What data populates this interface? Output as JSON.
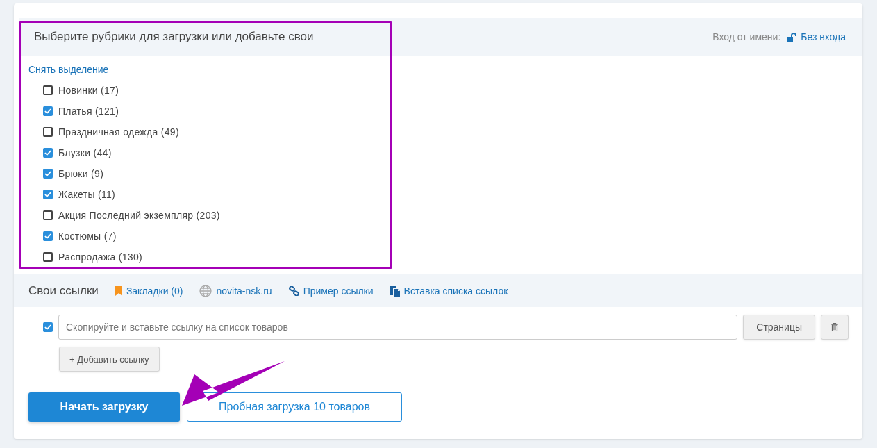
{
  "header": {
    "title": "Выберите рубрики для загрузки или добавьте свои",
    "login_label": "Вход от имени:",
    "login_value": "Без входа"
  },
  "deselect_link": "Снять выделение",
  "categories": [
    {
      "label": "Новинки (17)",
      "checked": false
    },
    {
      "label": "Платья (121)",
      "checked": true
    },
    {
      "label": "Праздничная одежда (49)",
      "checked": false
    },
    {
      "label": "Блузки (44)",
      "checked": true
    },
    {
      "label": "Брюки (9)",
      "checked": true
    },
    {
      "label": "Жакеты (11)",
      "checked": true
    },
    {
      "label": "Акция Последний экземпляр (203)",
      "checked": false
    },
    {
      "label": "Костюмы (7)",
      "checked": true
    },
    {
      "label": "Распродажа (130)",
      "checked": false
    }
  ],
  "links_bar": {
    "title": "Свои ссылки",
    "items": [
      {
        "kind": "bookmark",
        "label": "Закладки (0)"
      },
      {
        "kind": "site",
        "label": "novita-nsk.ru"
      },
      {
        "kind": "example",
        "label": "Пример ссылки"
      },
      {
        "kind": "paste",
        "label": "Вставка списка ссылок"
      }
    ]
  },
  "link_rows": [
    {
      "checked": true,
      "placeholder": "Скопируйте и вставьте ссылку на список товаров",
      "pages_button": "Страницы"
    }
  ],
  "add_link_button": "+ Добавить ссылку",
  "actions": {
    "start": "Начать загрузку",
    "trial": "Пробная загрузка 10 товаров"
  }
}
